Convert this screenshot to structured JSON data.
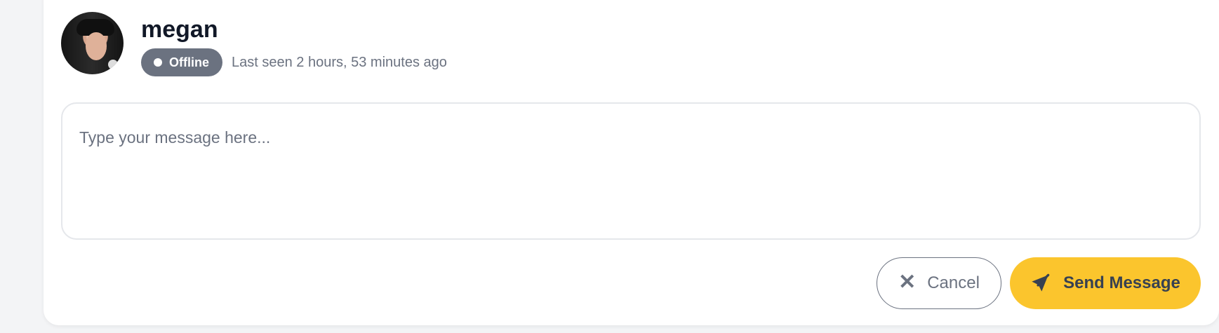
{
  "user": {
    "name": "megan",
    "status": "Offline",
    "last_seen": "Last seen 2 hours, 53 minutes ago"
  },
  "message": {
    "placeholder": "Type your message here..."
  },
  "actions": {
    "cancel_label": "Cancel",
    "cancel_icon": "close-icon",
    "send_label": "Send Message",
    "send_icon": "paper-plane-icon"
  },
  "colors": {
    "status_badge": "#6b7280",
    "send_button": "#fbc52d",
    "card_background": "#ffffff"
  }
}
